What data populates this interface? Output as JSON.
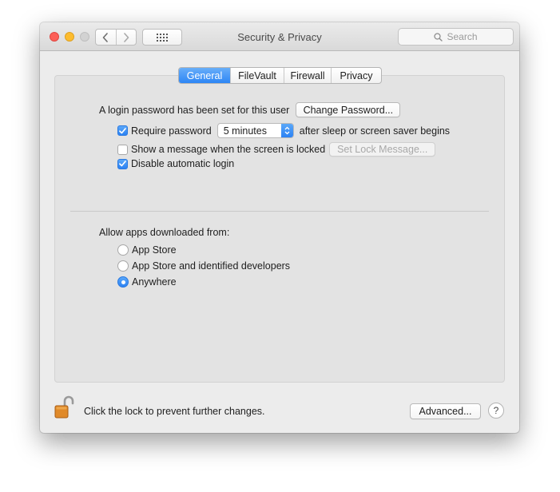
{
  "window": {
    "title": "Security & Privacy"
  },
  "search": {
    "placeholder": "Search"
  },
  "tabs": [
    {
      "label": "General",
      "active": true
    },
    {
      "label": "FileVault",
      "active": false
    },
    {
      "label": "Firewall",
      "active": false
    },
    {
      "label": "Privacy",
      "active": false
    }
  ],
  "general": {
    "login_password_text": "A login password has been set for this user",
    "change_password_label": "Change Password...",
    "require_password": {
      "label": "Require password",
      "checked": true,
      "interval": "5 minutes",
      "suffix": "after sleep or screen saver begins"
    },
    "show_message": {
      "label": "Show a message when the screen is locked",
      "checked": false,
      "button_label": "Set Lock Message..."
    },
    "disable_auto_login": {
      "label": "Disable automatic login",
      "checked": true
    }
  },
  "allow_apps": {
    "heading": "Allow apps downloaded from:",
    "options": [
      {
        "label": "App Store",
        "selected": false
      },
      {
        "label": "App Store and identified developers",
        "selected": false
      },
      {
        "label": "Anywhere",
        "selected": true
      }
    ]
  },
  "footer": {
    "lock_text": "Click the lock to prevent further changes.",
    "advanced_label": "Advanced...",
    "help_label": "?"
  },
  "colors": {
    "accent": "#2d86f5",
    "lock_body": "#e08a2a"
  }
}
